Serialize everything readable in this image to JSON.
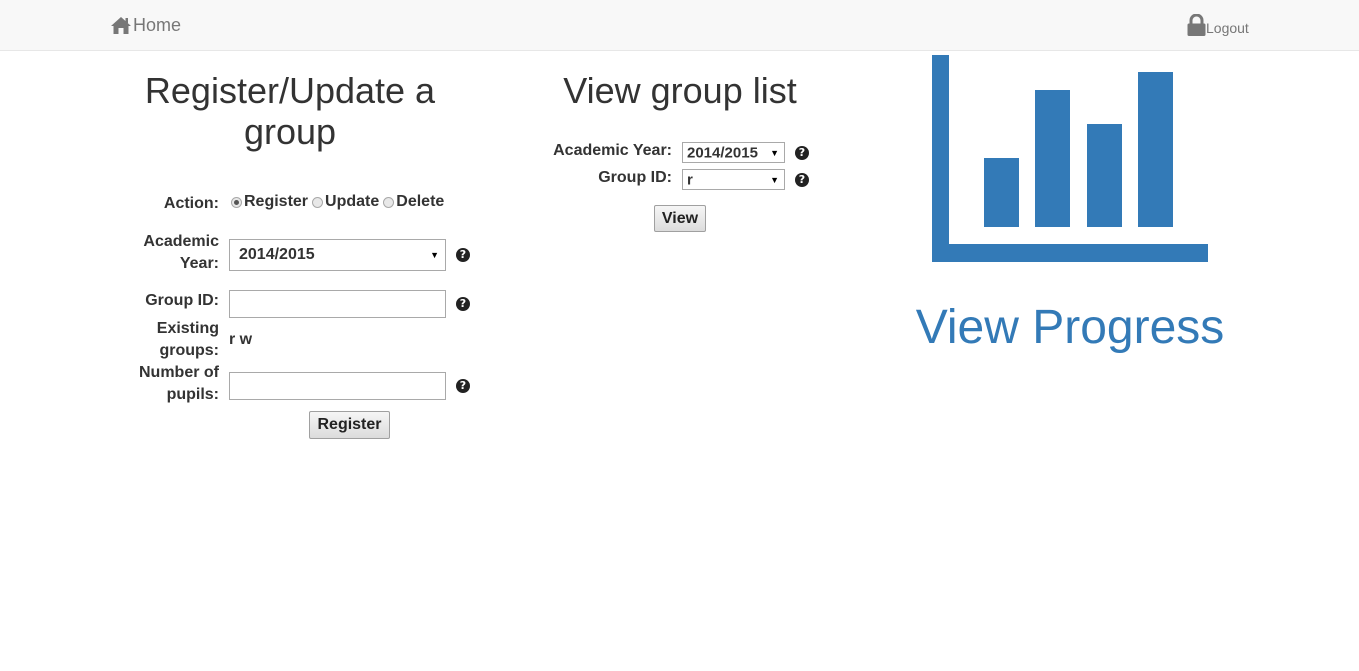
{
  "nav": {
    "home_label": "Home",
    "logout_label": "Logout",
    "home_icon": "home-icon",
    "logout_icon": "lock-icon"
  },
  "register": {
    "title": "Register/Update a group",
    "action_label": "Action:",
    "actions": [
      {
        "label": "Register",
        "selected": true
      },
      {
        "label": "Update",
        "selected": false
      },
      {
        "label": "Delete",
        "selected": false
      }
    ],
    "academic_year_label_line1": "Academic",
    "academic_year_label_line2": "Year:",
    "academic_year_value": "2014/2015",
    "group_id_label": "Group ID:",
    "group_id_value": "",
    "existing_groups_label_line1": "Existing",
    "existing_groups_label_line2": "groups:",
    "existing_groups_value": "r w",
    "pupils_label_line1": "Number of",
    "pupils_label_line2": "pupils:",
    "pupils_value": "",
    "submit_label": "Register"
  },
  "view": {
    "title": "View group list",
    "academic_year_label": "Academic Year:",
    "academic_year_value": "2014/2015",
    "group_id_label": "Group ID:",
    "group_id_value": "r",
    "submit_label": "View"
  },
  "progress": {
    "label": "View Progress",
    "icon": "bar-chart-icon",
    "color": "#337ab7"
  },
  "help_glyph": "?"
}
